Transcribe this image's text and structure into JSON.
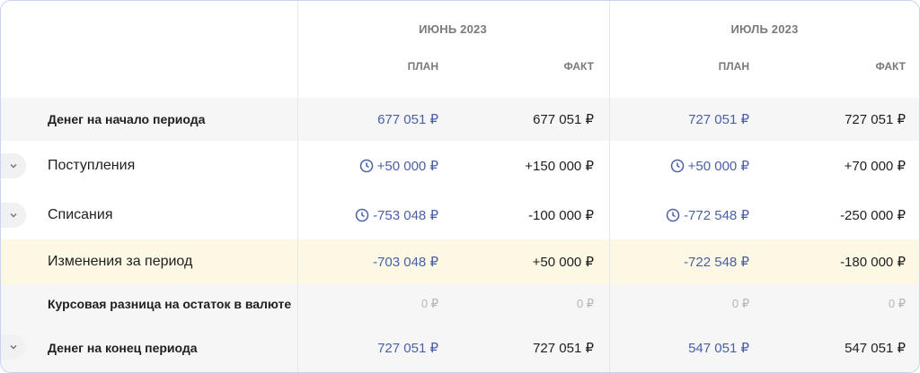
{
  "months": [
    {
      "title": "ИЮНЬ 2023",
      "plan_label": "ПЛАН",
      "fact_label": "ФАКТ"
    },
    {
      "title": "ИЮЛЬ 2023",
      "plan_label": "ПЛАН",
      "fact_label": "ФАКТ"
    }
  ],
  "rows": [
    {
      "label": "Денег на начало периода",
      "jun_plan": "677 051 ₽",
      "jun_fact": "677 051 ₽",
      "jul_plan": "727 051 ₽",
      "jul_fact": "727 051 ₽"
    },
    {
      "label": "Поступления",
      "jun_plan": "+50 000 ₽",
      "jun_fact": "+150 000 ₽",
      "jul_plan": "+50 000 ₽",
      "jul_fact": "+70 000 ₽"
    },
    {
      "label": "Списания",
      "jun_plan": "-753 048 ₽",
      "jun_fact": "-100 000 ₽",
      "jul_plan": "-772 548 ₽",
      "jul_fact": "-250 000 ₽"
    },
    {
      "label": "Изменения за период",
      "jun_plan": "-703 048 ₽",
      "jun_fact": "+50 000 ₽",
      "jul_plan": "-722 548 ₽",
      "jul_fact": "-180 000 ₽"
    },
    {
      "label": "Курсовая разница на остаток в валюте",
      "jun_plan": "0 ₽",
      "jun_fact": "0 ₽",
      "jul_plan": "0 ₽",
      "jul_fact": "0 ₽"
    },
    {
      "label": "Денег на конец периода",
      "jun_plan": "727 051 ₽",
      "jun_fact": "727 051 ₽",
      "jul_plan": "547 051 ₽",
      "jul_fact": "547 051 ₽"
    }
  ],
  "icons": {
    "expand": "chevron-down-icon",
    "planned": "clock-icon"
  },
  "colors": {
    "plan": "#4a5fa8",
    "fact": "#1f1f1f",
    "highlight_row": "#fdf8e4",
    "border": "#c9d3f0"
  }
}
